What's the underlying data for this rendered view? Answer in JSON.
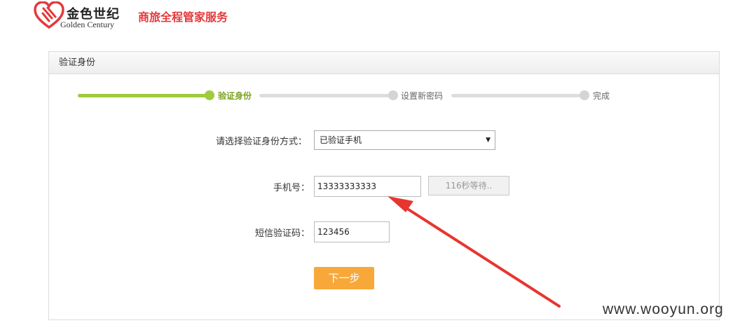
{
  "header": {
    "logo_cn": "金色世纪",
    "logo_en": "Golden Century",
    "slogan": "商旅全程管家服务"
  },
  "panel": {
    "title": "验证身份"
  },
  "steps": [
    {
      "label": "验证身份",
      "state": "active"
    },
    {
      "label": "设置新密码",
      "state": "pending"
    },
    {
      "label": "完成",
      "state": "pending"
    }
  ],
  "form": {
    "method_label": "请选择验证身份方式：",
    "method_selected": "已验证手机",
    "phone_label": "手机号：",
    "phone_value": "13333333333",
    "wait_button": "116秒等待..",
    "code_label": "短信验证码：",
    "code_value": "123456",
    "next_button": "下一步"
  },
  "colors": {
    "brand_red": "#e4393c",
    "progress_active": "#9fcb3c",
    "progress_inactive": "#dddddd",
    "next_button": "#f7a839",
    "annotation_arrow": "#e8352f"
  },
  "watermark": "www.wooyun.org"
}
